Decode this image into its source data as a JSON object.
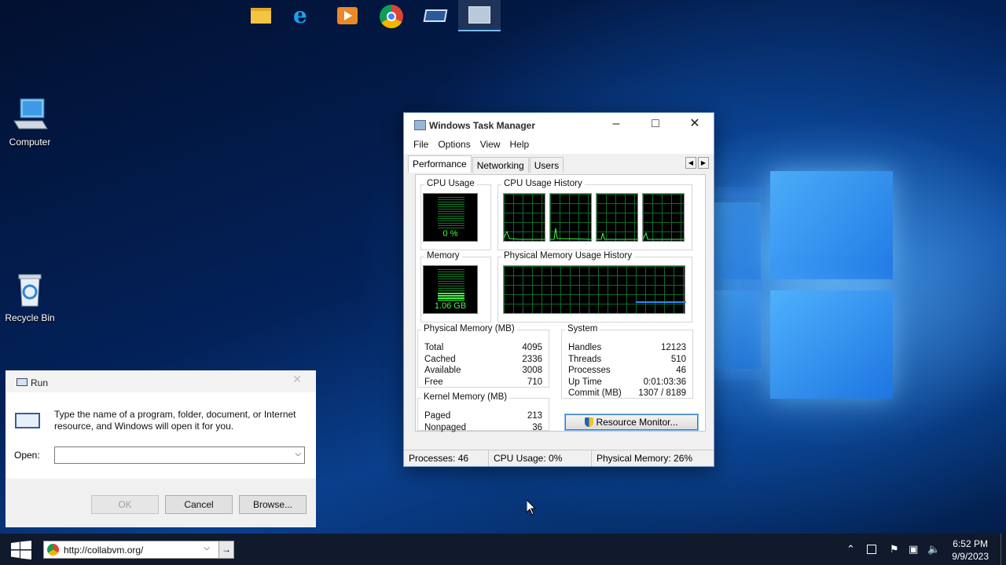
{
  "desktop": {
    "icons": [
      {
        "label": "Computer"
      },
      {
        "label": "Recycle Bin"
      }
    ]
  },
  "task_manager": {
    "title": "Windows Task Manager",
    "menu": [
      "File",
      "Options",
      "View",
      "Help"
    ],
    "tabs": [
      "Performance",
      "Networking",
      "Users"
    ],
    "cpu_usage_label": "CPU Usage",
    "cpu_usage_value": "0 %",
    "cpu_history_label": "CPU Usage History",
    "memory_label": "Memory",
    "memory_value": "1.06 GB",
    "memory_history_label": "Physical Memory Usage History",
    "physical_memory": {
      "title": "Physical Memory (MB)",
      "rows": [
        {
          "label": "Total",
          "value": "4095"
        },
        {
          "label": "Cached",
          "value": "2336"
        },
        {
          "label": "Available",
          "value": "3008"
        },
        {
          "label": "Free",
          "value": "710"
        }
      ]
    },
    "kernel_memory": {
      "title": "Kernel Memory (MB)",
      "rows": [
        {
          "label": "Paged",
          "value": "213"
        },
        {
          "label": "Nonpaged",
          "value": "36"
        }
      ]
    },
    "system": {
      "title": "System",
      "rows": [
        {
          "label": "Handles",
          "value": "12123"
        },
        {
          "label": "Threads",
          "value": "510"
        },
        {
          "label": "Processes",
          "value": "46"
        },
        {
          "label": "Up Time",
          "value": "0:01:03:36"
        },
        {
          "label": "Commit (MB)",
          "value": "1307 / 8189"
        }
      ]
    },
    "resource_monitor_button": "Resource Monitor...",
    "status": {
      "processes": "Processes: 46",
      "cpu": "CPU Usage: 0%",
      "memory": "Physical Memory: 26%"
    }
  },
  "run_dialog": {
    "title": "Run",
    "description": "Type the name of a program, folder, document, or Internet resource, and Windows will open it for you.",
    "open_label": "Open:",
    "open_value": "",
    "ok": "OK",
    "cancel": "Cancel",
    "browse": "Browse..."
  },
  "taskbar": {
    "address": "http://collabvm.org/",
    "time": "6:52 PM",
    "date": "9/9/2023"
  }
}
